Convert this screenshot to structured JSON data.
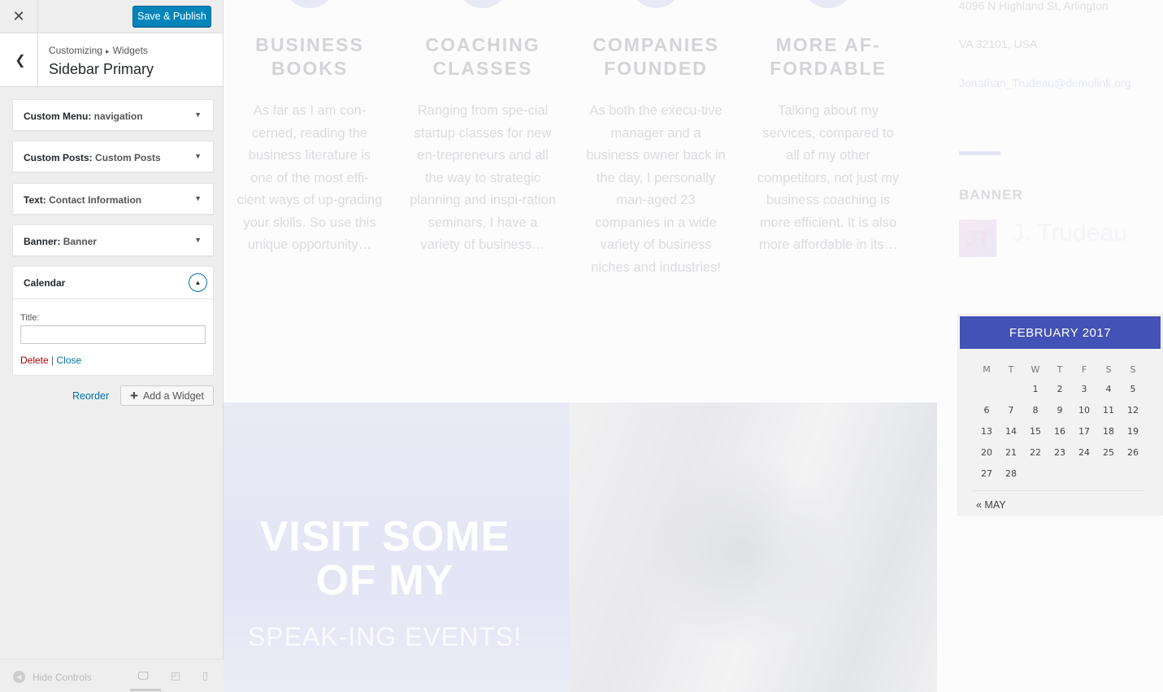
{
  "customizer": {
    "close_icon": "close-icon",
    "publish_label": "Save & Publish",
    "breadcrumb": {
      "root": "Customizing",
      "current": "Widgets"
    },
    "section_title": "Sidebar Primary",
    "widgets": [
      {
        "type": "Custom Menu:",
        "instance": "navigation"
      },
      {
        "type": "Custom Posts:",
        "instance": "Custom Posts"
      },
      {
        "type": "Text:",
        "instance": "Contact Information"
      },
      {
        "type": "Banner:",
        "instance": "Banner"
      }
    ],
    "expanded_widget": {
      "title": "Calendar",
      "field_label": "Title:",
      "field_value": "",
      "delete_label": "Delete",
      "separator": "|",
      "close_label": "Close"
    },
    "reorder_label": "Reorder",
    "add_widget_label": "Add a Widget",
    "footer": {
      "hide_controls_label": "Hide Controls",
      "active_device": "desktop"
    }
  },
  "preview": {
    "features": [
      {
        "title": "BUSINESS BOOKS",
        "text": "As far as I am con-cerned, reading the business literature is one of the most effi-cient ways of up-grading your skills. So use this unique opportunity…"
      },
      {
        "title": "COACHING CLASSES",
        "text": "Ranging from spe-cial startup classes for new en-trepreneurs and all the way to strategic planning and inspi-ration seminars, I have a variety of business…"
      },
      {
        "title": "COMPANIES FOUNDED",
        "text": "As both the execu-tive manager and a business owner back in the day, I personally man-aged 23 companies in a wide variety of business niches and industries!"
      },
      {
        "title": "MORE AF-FORDABLE",
        "text": "Talking about my services, compared to all of my other competitors, not just my business coaching is more efficient. It is also more affordable in its…"
      }
    ],
    "hero_title": "VISIT SOME OF MY",
    "hero_subtitle": "SPEAK-ING EVENTS!",
    "contact": {
      "address_line1": "4096 N Highland St, Arlington",
      "address_line2": "VA 32101, USA",
      "email": "Jonathan_Trudeau@demolink.org"
    },
    "banner": {
      "title": "BANNER",
      "logo_text": "JT",
      "name": "J. Trudeau"
    },
    "calendar": {
      "caption": "FEBRUARY 2017",
      "weekdays": [
        "M",
        "T",
        "W",
        "T",
        "F",
        "S",
        "S"
      ],
      "weeks": [
        [
          "",
          "",
          "1",
          "2",
          "3",
          "4",
          "5"
        ],
        [
          "6",
          "7",
          "8",
          "9",
          "10",
          "11",
          "12"
        ],
        [
          "13",
          "14",
          "15",
          "16",
          "17",
          "18",
          "19"
        ],
        [
          "20",
          "21",
          "22",
          "23",
          "24",
          "25",
          "26"
        ],
        [
          "27",
          "28",
          "",
          "",
          "",
          "",
          ""
        ]
      ],
      "prev_label": "« MAY"
    }
  }
}
